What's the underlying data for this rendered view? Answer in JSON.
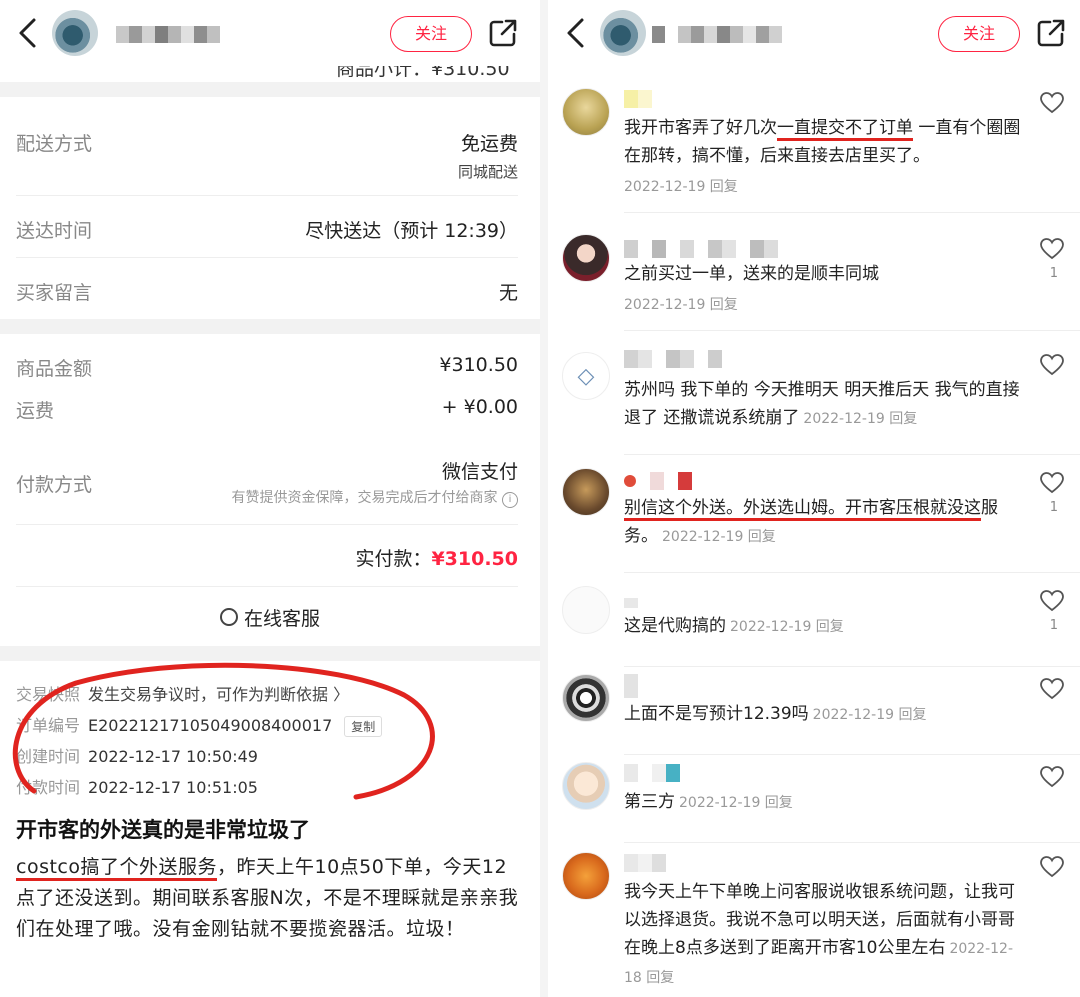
{
  "left": {
    "header": {
      "follow_label": "关注"
    },
    "top_partial": "商品小计：¥310.50",
    "delivery": {
      "method_label": "配送方式",
      "method_value": "免运费",
      "method_sub": "同城配送",
      "time_label": "送达时间",
      "time_value": "尽快送达（预计 12:39）",
      "note_label": "买家留言",
      "note_value": "无"
    },
    "payment": {
      "goods_label": "商品金额",
      "goods_value": "¥310.50",
      "freight_label": "运费",
      "freight_value": "+ ¥0.00",
      "pay_label": "付款方式",
      "pay_value": "微信支付",
      "pay_sub": "有赞提供资金保障，交易完成后才付给商家",
      "actual_label": "实付款：",
      "actual_value": "¥310.50",
      "service_label": "在线客服"
    },
    "order_meta": {
      "snapshot_label": "交易快照",
      "snapshot_value": "发生交易争议时，可作为判断依据 〉",
      "no_label": "订单编号",
      "no_value": "E20221217105049008400017",
      "copy_label": "复制",
      "created_label": "创建时间",
      "created_value": "2022-12-17 10:50:49",
      "paid_label": "付款时间",
      "paid_value": "2022-12-17 10:51:05"
    },
    "post": {
      "title": "开市客的外送真的是非常垃圾了",
      "body_hl": "costco搞了个外送服务",
      "body_rest": "，昨天上午10点50下单，今天12点了还没送到。期间联系客服N次，不是不理睬就是亲亲我们在处理了哦。没有金刚钻就不要揽瓷器活。垃圾！"
    }
  },
  "right": {
    "header": {
      "follow_label": "关注"
    },
    "comments": [
      {
        "pre": "我开市客弄了好几次",
        "hl": "一直提交不了订单",
        "post": " 一直有个圈圈在那转，搞不懂，后来直接去店里买了。",
        "date": "2022-12-19 回复",
        "likes": ""
      },
      {
        "pre": "之前买过一单，送来的是顺丰同城",
        "hl": "",
        "post": "",
        "date": "2022-12-19 回复",
        "likes": "1"
      },
      {
        "pre": "苏州吗 我下单的 今天推明天 明天推后天 我气的直接退了 还撒谎说系统崩了",
        "hl": "",
        "post": "",
        "date": "2022-12-19 回复",
        "likes": ""
      },
      {
        "pre": "",
        "hl": "别信这个外送。外送选山姆。开市客压根就没这",
        "post": "服务。",
        "date": "2022-12-19 回复",
        "likes": "1"
      },
      {
        "pre": "这是代购搞的",
        "hl": "",
        "post": "",
        "date": "2022-12-19 回复",
        "likes": "1"
      },
      {
        "pre": "上面不是写预计12.39吗",
        "hl": "",
        "post": "",
        "date": "2022-12-19 回复",
        "likes": ""
      },
      {
        "pre": "第三方",
        "hl": "",
        "post": "",
        "date": "2022-12-19 回复",
        "likes": ""
      },
      {
        "pre": "我今天上午下单晚上问客服说收银系统问题，让我可以选择退货。我说不急可以明天送，后面就有小哥哥在晚上8点多送到了距离开市客10公里左右",
        "hl": "",
        "post": "",
        "date": "2022-12-18 回复",
        "likes": ""
      }
    ]
  },
  "colors": {
    "accent": "#ff2442",
    "annotation": "#e0241f"
  }
}
